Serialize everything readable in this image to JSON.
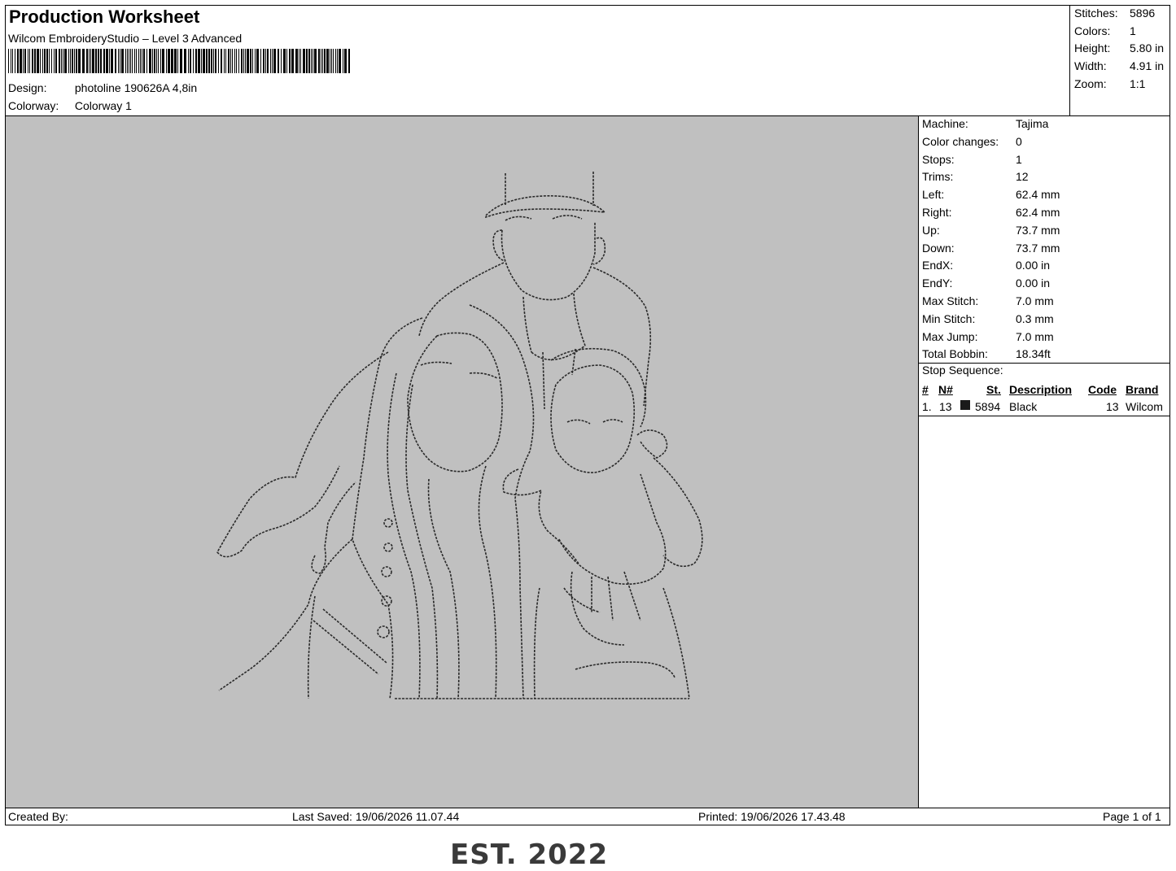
{
  "header": {
    "title": "Production Worksheet",
    "software": "Wilcom EmbroideryStudio – Level 3 Advanced",
    "design_label": "Design:",
    "design_value": "photoline 190626A 4,8in",
    "colorway_label": "Colorway:",
    "colorway_value": "Colorway 1"
  },
  "summary": [
    {
      "label": "Stitches:",
      "value": "5896"
    },
    {
      "label": "Colors:",
      "value": "1"
    },
    {
      "label": "Height:",
      "value": "5.80 in"
    },
    {
      "label": "Width:",
      "value": "4.91 in"
    },
    {
      "label": "Zoom:",
      "value": "1:1"
    }
  ],
  "specs": [
    {
      "label": "Machine:",
      "value": "Tajima"
    },
    {
      "label": "Color changes:",
      "value": "0"
    },
    {
      "label": "Stops:",
      "value": "1"
    },
    {
      "label": "Trims:",
      "value": "12"
    },
    {
      "label": "Left:",
      "value": "62.4 mm"
    },
    {
      "label": "Right:",
      "value": "62.4 mm"
    },
    {
      "label": "Up:",
      "value": "73.7 mm"
    },
    {
      "label": "Down:",
      "value": "73.7 mm"
    },
    {
      "label": "EndX:",
      "value": "0.00 in"
    },
    {
      "label": "EndY:",
      "value": "0.00 in"
    },
    {
      "label": "Max Stitch:",
      "value": "7.0 mm"
    },
    {
      "label": "Min Stitch:",
      "value": "0.3 mm"
    },
    {
      "label": "Max Jump:",
      "value": "7.0 mm"
    },
    {
      "label": "Total Bobbin:",
      "value": "18.34ft"
    }
  ],
  "stop_sequence": {
    "title": "Stop Sequence:",
    "columns": [
      "#",
      "N#",
      "St.",
      "Description",
      "Code",
      "Brand"
    ],
    "rows": [
      {
        "num": "1.",
        "n": "13",
        "st": "5894",
        "description": "Black",
        "code": "13",
        "brand": "Wilcom",
        "swatch_color": "#1a1a1a"
      }
    ]
  },
  "design_text": "EST. 2022",
  "footer": {
    "created_by": "Created By:",
    "last_saved": "Last Saved: 19/06/2026 11.07.44",
    "printed": "Printed: 19/06/2026 17.43.48",
    "page": "Page 1 of 1"
  },
  "colors": {
    "canvas_bg": "#c0c0c0",
    "thread": "#1a1a1a"
  }
}
